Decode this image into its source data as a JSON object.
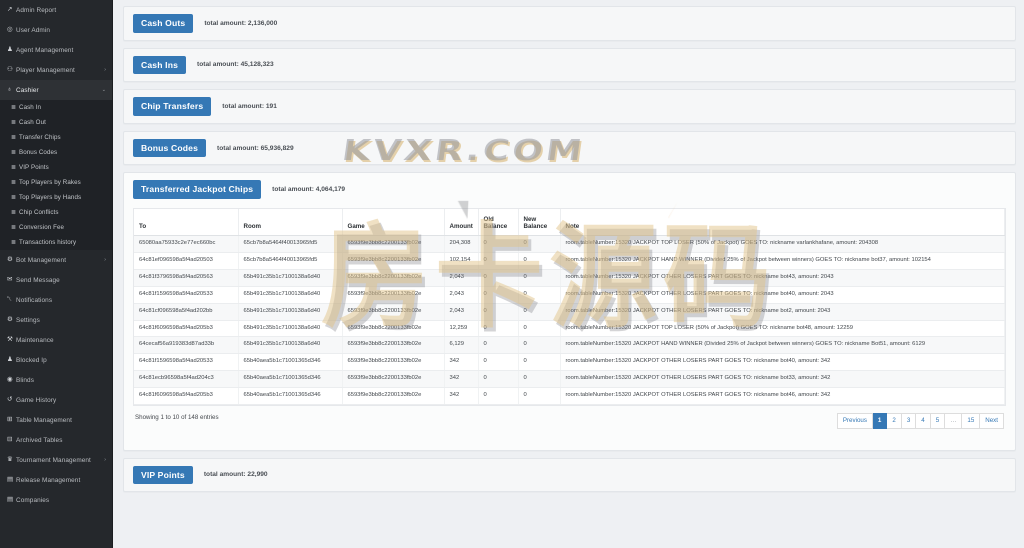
{
  "sidebar": {
    "items": [
      {
        "label": "Admin Report",
        "icon": "chart-icon",
        "glyph": "↗",
        "type": "item"
      },
      {
        "label": "User Admin",
        "icon": "user-circle-icon",
        "glyph": "◎",
        "type": "item"
      },
      {
        "label": "Agent Management",
        "icon": "agent-icon",
        "glyph": "♟",
        "type": "item"
      },
      {
        "label": "Player Management",
        "icon": "players-icon",
        "glyph": "⚇",
        "type": "item",
        "caret": "›"
      },
      {
        "label": "Cashier",
        "icon": "cashier-icon",
        "glyph": "♁",
        "type": "parent",
        "caret": "⌄",
        "expanded": true
      },
      {
        "label": "Cash In",
        "icon": "list-icon",
        "glyph": "≣",
        "type": "sub"
      },
      {
        "label": "Cash Out",
        "icon": "list-icon",
        "glyph": "≣",
        "type": "sub"
      },
      {
        "label": "Transfer Chips",
        "icon": "list-icon",
        "glyph": "≣",
        "type": "sub"
      },
      {
        "label": "Bonus Codes",
        "icon": "list-icon",
        "glyph": "≣",
        "type": "sub"
      },
      {
        "label": "VIP Points",
        "icon": "list-icon",
        "glyph": "≣",
        "type": "sub"
      },
      {
        "label": "Top Players by Rakes",
        "icon": "list-icon",
        "glyph": "≣",
        "type": "sub"
      },
      {
        "label": "Top Players by Hands",
        "icon": "list-icon",
        "glyph": "≣",
        "type": "sub"
      },
      {
        "label": "Chip Conflicts",
        "icon": "list-icon",
        "glyph": "≣",
        "type": "sub"
      },
      {
        "label": "Conversion Fee",
        "icon": "list-icon",
        "glyph": "≣",
        "type": "sub"
      },
      {
        "label": "Transactions history",
        "icon": "list-icon",
        "glyph": "≣",
        "type": "sub"
      },
      {
        "label": "Bot Management",
        "icon": "bot-icon",
        "glyph": "⚙",
        "type": "item",
        "caret": "›"
      },
      {
        "label": "Send Message",
        "icon": "envelope-icon",
        "glyph": "✉",
        "type": "item"
      },
      {
        "label": "Notifications",
        "icon": "bell-icon",
        "glyph": "␇",
        "type": "item"
      },
      {
        "label": "Settings",
        "icon": "gear-icon",
        "glyph": "⚙",
        "type": "item"
      },
      {
        "label": "Maintenance",
        "icon": "wrench-icon",
        "glyph": "⚒",
        "type": "item"
      },
      {
        "label": "Blocked Ip",
        "icon": "blocked-user-icon",
        "glyph": "♟",
        "type": "item"
      },
      {
        "label": "Blinds",
        "icon": "blinds-icon",
        "glyph": "◉",
        "type": "item"
      },
      {
        "label": "Game History",
        "icon": "history-icon",
        "glyph": "↺",
        "type": "item"
      },
      {
        "label": "Table Management",
        "icon": "table-icon",
        "glyph": "⊞",
        "type": "item"
      },
      {
        "label": "Archived Tables",
        "icon": "archive-icon",
        "glyph": "⊟",
        "type": "item"
      },
      {
        "label": "Tournament Management",
        "icon": "trophy-icon",
        "glyph": "♛",
        "type": "item",
        "caret": "›"
      },
      {
        "label": "Release Management",
        "icon": "release-icon",
        "glyph": "▤",
        "type": "item"
      },
      {
        "label": "Companies",
        "icon": "building-icon",
        "glyph": "▤",
        "type": "item"
      }
    ]
  },
  "colors": {
    "accent_blue": "#3578b5",
    "sidebar_bg": "#25282c",
    "page_bg": "#eef0f3"
  },
  "summary_panels": [
    {
      "button": "Cash Outs",
      "total": "total amount: 2,136,000"
    },
    {
      "button": "Cash Ins",
      "total": "total amount: 45,128,323"
    },
    {
      "button": "Chip Transfers",
      "total": "total amount: 191"
    },
    {
      "button": "Bonus Codes",
      "total": "total amount: 65,936,829"
    }
  ],
  "jackpot_panel": {
    "button": "Transferred Jackpot Chips",
    "total": "total amount: 4,064,179",
    "columns": [
      "To",
      "Room",
      "Game",
      "Amount",
      "Old Balance",
      "New Balance",
      "Note"
    ],
    "rows": [
      {
        "to": "65080aa75933c2e77ec660bc",
        "room": "65cb7b8a5464f40013965fd5",
        "game": "6593f9e3bb8c2200133fb02e",
        "amount": "204,308",
        "old_balance": "0",
        "new_balance": "0",
        "note": "room.tableNumber:15320 JACKPOT TOP LOSER (50% of Jackpot) GOES TO: nickname varlankhafane, amount: 204308"
      },
      {
        "to": "64c81ef096598a5f4ad20503",
        "room": "65cb7b8a5464f40013965fd5",
        "game": "6593f9e3bb8c2200133fb02e",
        "amount": "102,154",
        "old_balance": "0",
        "new_balance": "0",
        "note": "room.tableNumber:15320 JACKPOT HAND WINNER (Divided 25% of Jackpot between winners) GOES TO: nickname bot37, amount: 102154"
      },
      {
        "to": "64c81f3796598a5f4ad20563",
        "room": "65b491c35b1c7100138a6d40",
        "game": "6593f9e3bb8c2200133fb02e",
        "amount": "2,043",
        "old_balance": "0",
        "new_balance": "0",
        "note": "room.tableNumber:15320 JACKPOT OTHER LOSERS PART GOES TO: nickname bot43, amount: 2043"
      },
      {
        "to": "64c81f1596598a5f4ad20533",
        "room": "65b491c35b1c7100138a6d40",
        "game": "6593f9e3bb8c2200133fb02e",
        "amount": "2,043",
        "old_balance": "0",
        "new_balance": "0",
        "note": "room.tableNumber:15320 JACKPOT OTHER LOSERS PART GOES TO: nickname bot40, amount: 2043"
      },
      {
        "to": "64c81cf096598a5f4ad202bb",
        "room": "65b491c35b1c7100138a6d40",
        "game": "6593f9e3bb8c2200133fb02e",
        "amount": "2,043",
        "old_balance": "0",
        "new_balance": "0",
        "note": "room.tableNumber:15320 JACKPOT OTHER LOSERS PART GOES TO: nickname bot2, amount: 2043"
      },
      {
        "to": "64c81f6096598a5f4ad205b3",
        "room": "65b491c35b1c7100138a6d40",
        "game": "6593f9e3bb8c2200133fb02e",
        "amount": "12,259",
        "old_balance": "0",
        "new_balance": "0",
        "note": "room.tableNumber:15320 JACKPOT TOP LOSER (50% of Jackpot) GOES TO: nickname bot48, amount: 12259"
      },
      {
        "to": "64cecaf56a919383d87ad33b",
        "room": "65b491c35b1c7100138a6d40",
        "game": "6593f9e3bb8c2200133fb02e",
        "amount": "6,129",
        "old_balance": "0",
        "new_balance": "0",
        "note": "room.tableNumber:15320 JACKPOT HAND WINNER (Divided 25% of Jackpot between winners) GOES TO: nickname Bot51, amount: 6129"
      },
      {
        "to": "64c81f1596598a5f4ad20533",
        "room": "65b40aea5b1c71001365d346",
        "game": "6593f9e3bb8c2200133fb02e",
        "amount": "342",
        "old_balance": "0",
        "new_balance": "0",
        "note": "room.tableNumber:15320 JACKPOT OTHER LOSERS PART GOES TO: nickname bot40, amount: 342"
      },
      {
        "to": "64c81ecb96598a5f4ad204c3",
        "room": "65b40aea5b1c71001365d346",
        "game": "6593f9e3bb8c2200133fb02e",
        "amount": "342",
        "old_balance": "0",
        "new_balance": "0",
        "note": "room.tableNumber:15320 JACKPOT OTHER LOSERS PART GOES TO: nickname bot33, amount: 342"
      },
      {
        "to": "64c81f6096598a5f4ad205b3",
        "room": "65b40aea5b1c71001365d346",
        "game": "6593f9e3bb8c2200133fb02e",
        "amount": "342",
        "old_balance": "0",
        "new_balance": "0",
        "note": "room.tableNumber:15320 JACKPOT OTHER LOSERS PART GOES TO: nickname bot46, amount: 342"
      }
    ],
    "showing": "Showing 1 to 10 of 148 entries",
    "pagination": {
      "previous": "Previous",
      "pages": [
        "1",
        "2",
        "3",
        "4",
        "5",
        "…",
        "15"
      ],
      "active": "1",
      "next": "Next"
    }
  },
  "vip_panel": {
    "button": "VIP Points",
    "total": "total amount: 22,990"
  },
  "watermark": {
    "top_text": "KVXR.COM",
    "cn_text": "房卡源码"
  }
}
